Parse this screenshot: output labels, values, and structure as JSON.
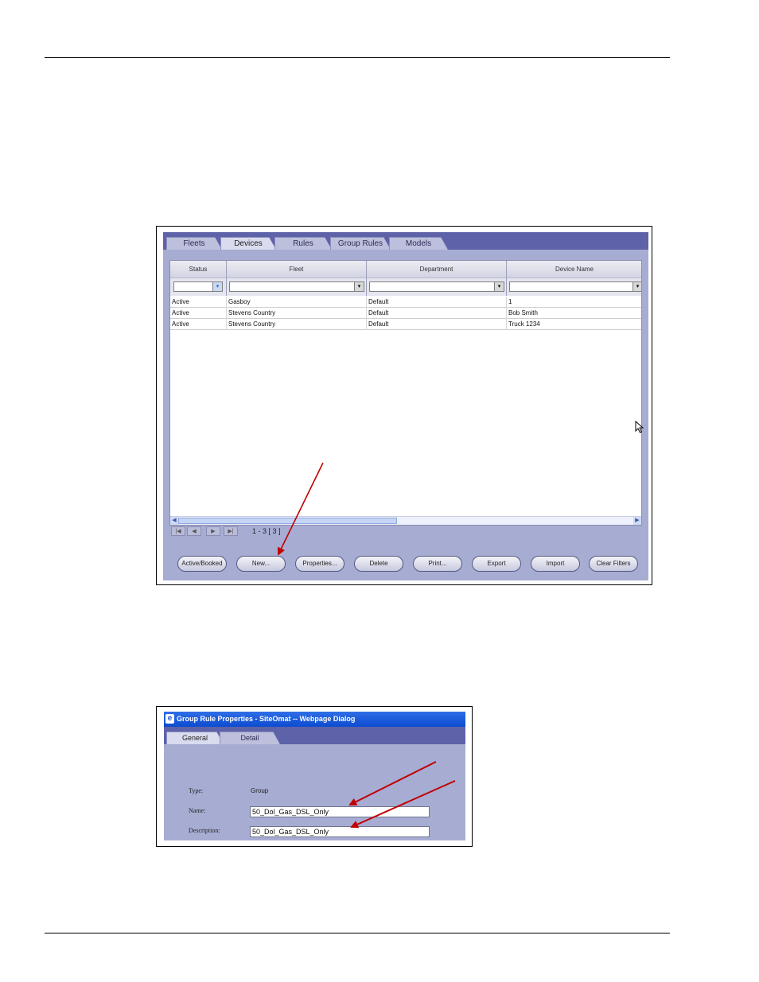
{
  "devices_window": {
    "tabs": [
      "Fleets",
      "Devices",
      "Rules",
      "Group Rules",
      "Models"
    ],
    "active_tab": "Devices",
    "columns": [
      "Status",
      "Fleet",
      "Department",
      "Device Name"
    ],
    "rows": [
      [
        "Active",
        "Gasboy",
        "Default",
        "1"
      ],
      [
        "Active",
        "Stevens Country",
        "Default",
        "Bob Smith"
      ],
      [
        "Active",
        "Stevens Country",
        "Default",
        "Truck 1234"
      ]
    ],
    "pager": {
      "info": "1 - 3  [ 3 ]",
      "first": "|◀",
      "prev": "◀",
      "next": "▶",
      "last": "▶|"
    },
    "buttons": [
      "Active/Booked",
      "New...",
      "Properties...",
      "Delete",
      "Print...",
      "Export",
      "Import",
      "Clear Filters"
    ]
  },
  "dialog": {
    "title": "Group Rule Properties - SiteOmat -- Webpage Dialog",
    "tabs": [
      "General",
      "Detail"
    ],
    "active_tab": "General",
    "type_label": "Type:",
    "type_value": "Group",
    "name_label": "Name:",
    "name_value": "50_Dol_Gas_DSL_Only",
    "description_label": "Description:",
    "description_value": "50_Dol_Gas_DSL_Only"
  },
  "colors": {
    "tab_strip": "#5e62a8",
    "panel": "#a7acd2",
    "annotation_arrow": "#c00000",
    "title_bar": "#0b4bd0"
  }
}
